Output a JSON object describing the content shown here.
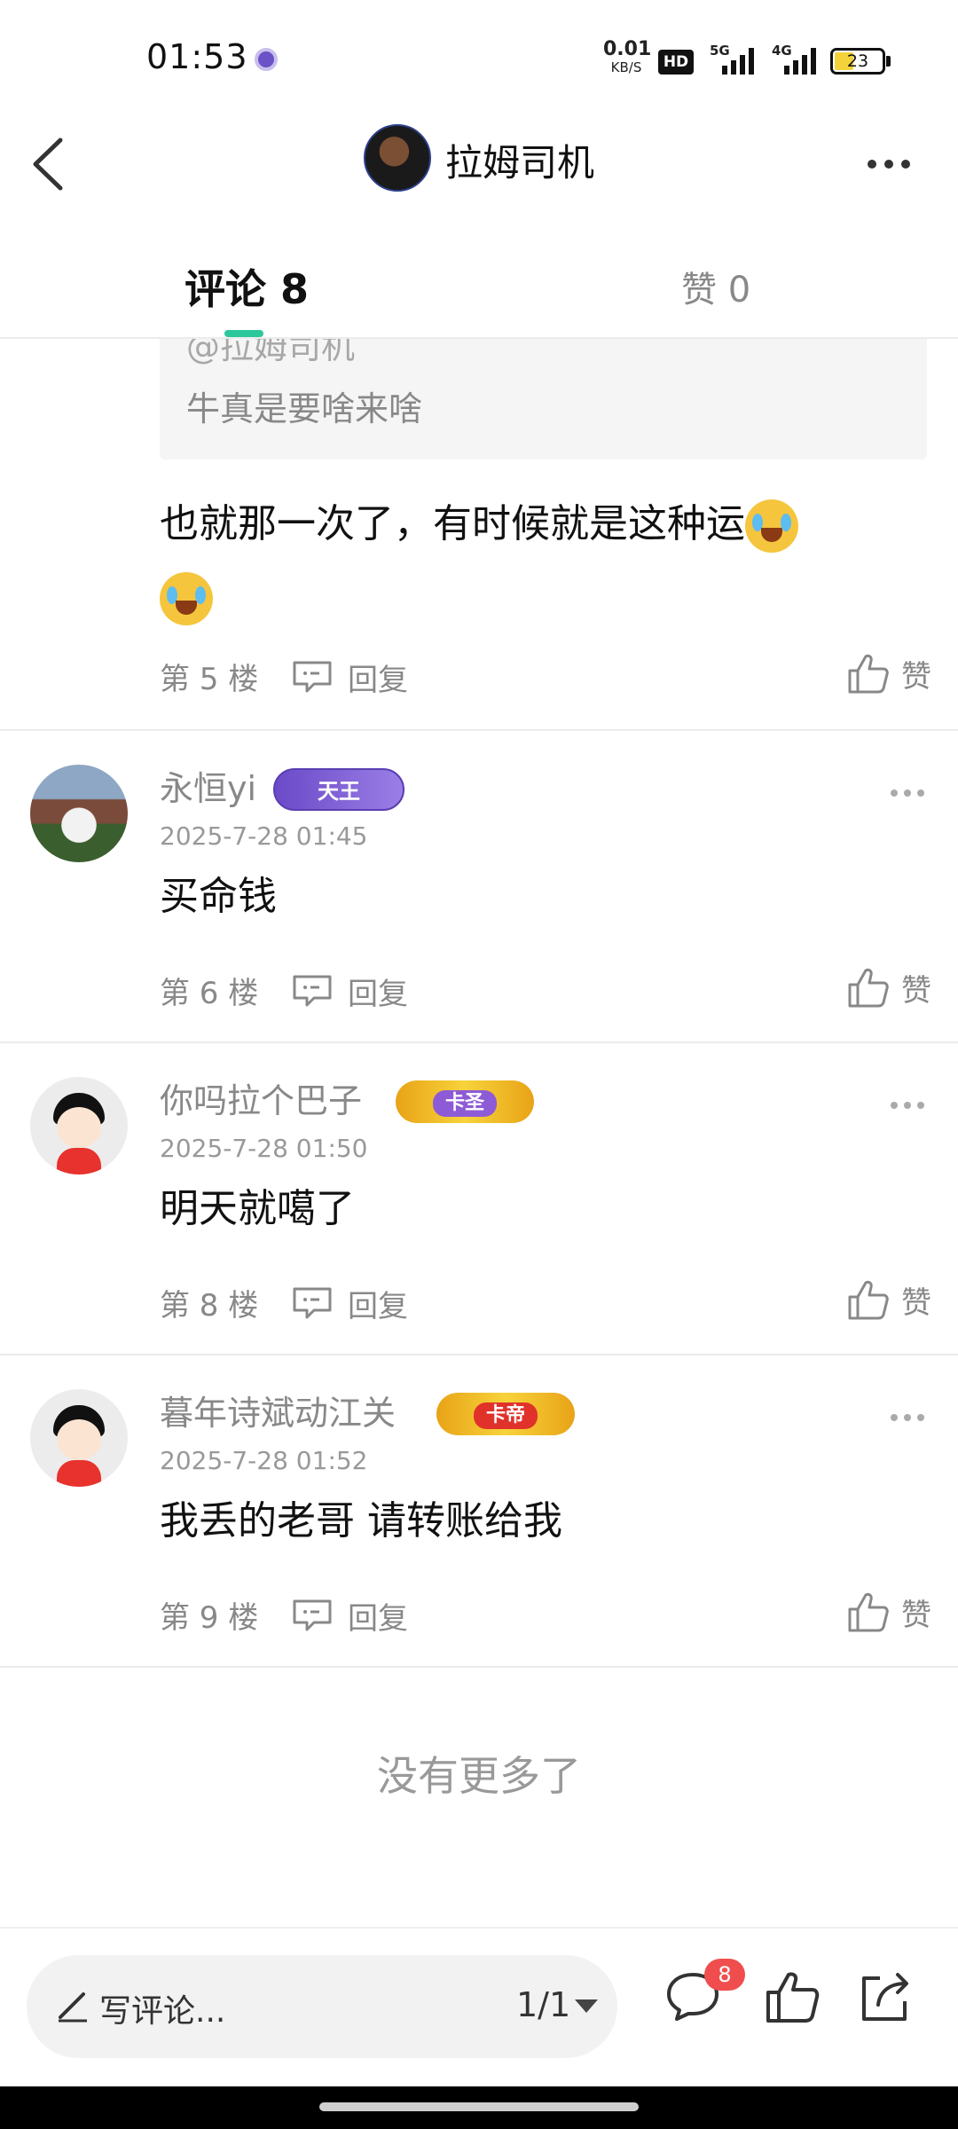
{
  "status_bar": {
    "time": "01:53",
    "net_speed_value": "0.01",
    "net_speed_unit": "KB/S",
    "hd_label": "HD",
    "signal_1": "5G",
    "signal_2": "4G",
    "battery_level": "23"
  },
  "header": {
    "title": "拉姆司机"
  },
  "tabs": {
    "comments": "评论 8",
    "likes": "赞 0"
  },
  "quoted_reply": {
    "author": "@拉姆司机",
    "text": "牛真是要啥来啥"
  },
  "reply": {
    "text": "也就那一次了，有时候就是这种运",
    "emoji": "crying-laughing-emoji",
    "floor": "第 5 楼",
    "reply_label": "回复",
    "like_label": "赞"
  },
  "comments": [
    {
      "username": "永恒yi",
      "badge": "天王",
      "timestamp": "2025-7-28 01:45",
      "text": "买命钱",
      "floor": "第 6 楼",
      "reply_label": "回复",
      "like_label": "赞"
    },
    {
      "username": "你吗拉个巴子",
      "badge": "卡圣",
      "timestamp": "2025-7-28 01:50",
      "text": "明天就噶了",
      "floor": "第 8 楼",
      "reply_label": "回复",
      "like_label": "赞"
    },
    {
      "username": "暮年诗斌动江关",
      "badge": "卡帝",
      "timestamp": "2025-7-28 01:52",
      "text": "我丢的老哥 请转账给我",
      "floor": "第 9 楼",
      "reply_label": "回复",
      "like_label": "赞"
    }
  ],
  "end_message": "没有更多了",
  "bottom_bar": {
    "input_placeholder": "写评论...",
    "page_indicator": "1/1",
    "comment_count": "8"
  },
  "colors": {
    "accent": "#2cc79a",
    "badge_red": "#f04e4e",
    "text_secondary": "#888888"
  }
}
